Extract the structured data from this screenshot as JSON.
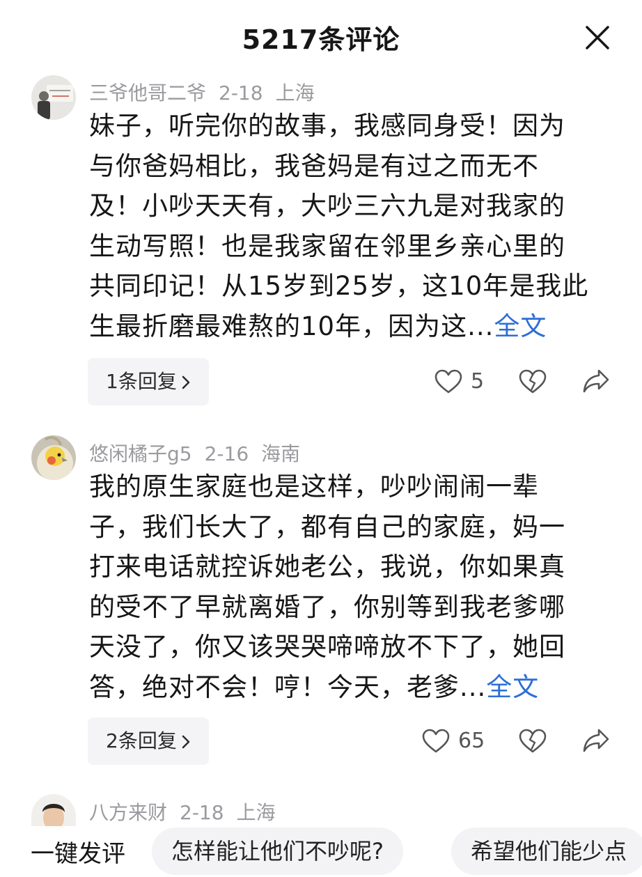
{
  "header": {
    "title": "5217条评论",
    "close_icon": "close-icon"
  },
  "comments": [
    {
      "user": "三爷他哥二爷",
      "date": "2-18",
      "location": "上海",
      "lines": [
        "妹子，听完你的故事，我感同身受！因为",
        "与你爸妈相比，我爸妈是有过之而无不",
        "及！小吵天天有，大吵三六九是对我家的",
        "生动写照！也是我家留在邻里乡亲心里的",
        "共同印记！从15岁到25岁，这10年是我此",
        "生最折磨最难熬的10年，因为这..."
      ],
      "more": "全文",
      "replies": "1条回复",
      "likes": "5"
    },
    {
      "user": "悠闲橘子g5",
      "date": "2-16",
      "location": "海南",
      "lines": [
        "我的原生家庭也是这样，吵吵闹闹一辈",
        "子，我们长大了，都有自己的家庭，妈一",
        "打来电话就控诉她老公，我说，你如果真",
        "的受不了早就离婚了，你别等到我老爹哪",
        "天没了，你又该哭哭啼啼放不下了，她回",
        "答，绝对不会！哼！今天，老爹..."
      ],
      "more": "全文",
      "replies": "2条回复",
      "likes": "65"
    },
    {
      "user": "八方来财",
      "date": "2-18",
      "location": "上海"
    }
  ],
  "bottom": {
    "label": "一键发评",
    "chips": [
      "怎样能让他们不吵呢?",
      "希望他们能少点"
    ]
  },
  "colors": {
    "link": "#2c6ed6",
    "meta": "#9a9a9f",
    "chip_bg": "#f3f3f5"
  }
}
